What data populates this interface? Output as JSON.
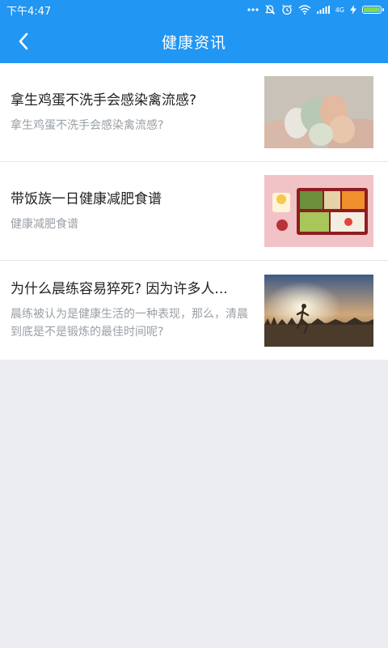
{
  "status_bar": {
    "time": "下午4:47",
    "network": "4G",
    "icons": [
      "more-dots-icon",
      "muted-bell-icon",
      "alarm-icon",
      "wifi-icon",
      "signal-icon",
      "charging-icon",
      "battery-icon"
    ]
  },
  "app_bar": {
    "title": "健康资讯",
    "back_icon": "chevron-left-icon"
  },
  "articles": [
    {
      "title": "拿生鸡蛋不洗手会感染禽流感?",
      "description": "拿生鸡蛋不洗手会感染禽流感?",
      "thumbnail": "eggs-in-hands-image"
    },
    {
      "title": "带饭族一日健康减肥食谱",
      "description": "健康减肥食谱",
      "thumbnail": "bento-lunchbox-image"
    },
    {
      "title": "为什么晨练容易猝死? 因为许多人...",
      "description": "晨练被认为是健康生活的一种表现，那么，清晨到底是不是锻炼的最佳时间呢?",
      "thumbnail": "morning-runner-image"
    }
  ],
  "colors": {
    "accent": "#2196f3",
    "background": "#ebedf1",
    "title_text": "#222222",
    "desc_text": "#9aa0a6"
  }
}
